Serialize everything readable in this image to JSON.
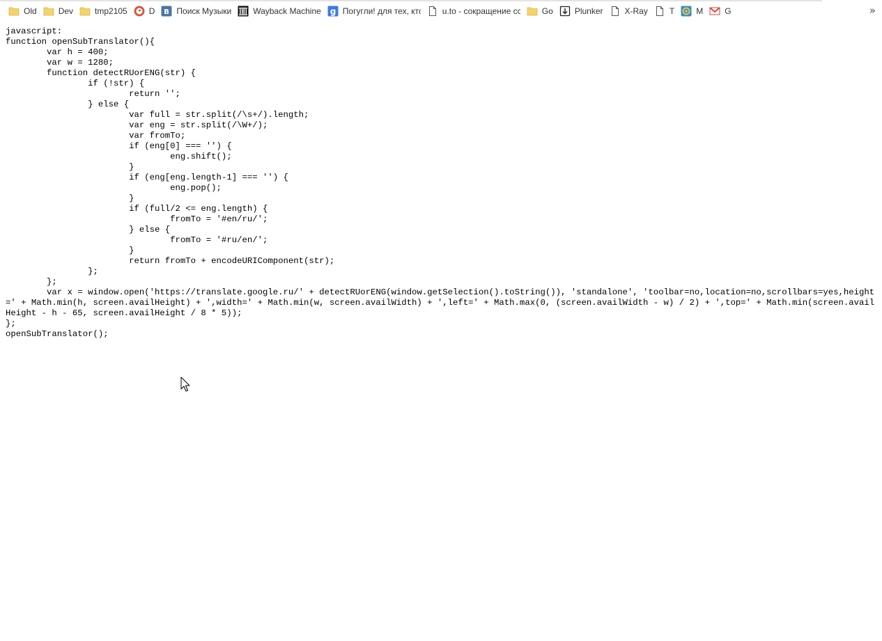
{
  "bookmarks_bar": {
    "items": [
      {
        "label": "Old",
        "icon": "folder-icon"
      },
      {
        "label": "Dev",
        "icon": "folder-icon"
      },
      {
        "label": "tmp2105",
        "icon": "folder-icon"
      },
      {
        "label": "D",
        "icon": "duckduckgo-icon"
      },
      {
        "label": "Поиск Музыки",
        "icon": "vk-icon"
      },
      {
        "label": "Wayback Machine",
        "icon": "wayback-machine-icon"
      },
      {
        "label": "Погугли! для тех, кто",
        "icon": "google-icon"
      },
      {
        "label": "u.to - сокращение ссылок",
        "icon": "page-icon"
      },
      {
        "label": "Go",
        "icon": "folder-icon"
      },
      {
        "label": "Plunker",
        "icon": "plunker-icon"
      },
      {
        "label": "X-Ray",
        "icon": "page-icon"
      },
      {
        "label": "T",
        "icon": "page-icon"
      },
      {
        "label": "M",
        "icon": "target-icon"
      },
      {
        "label": "G",
        "icon": "gmail-icon"
      }
    ],
    "overflow_glyph": "»"
  },
  "colors": {
    "folder": "#f5d36b",
    "vk": "#4c75a3",
    "google": "#3b7be5",
    "gmail_red": "#d44638",
    "text": "#000000"
  },
  "document": {
    "code": "javascript:\nfunction openSubTranslator(){\n\tvar h = 400;\n\tvar w = 1280;\n\tfunction detectRUorENG(str) {\n\t\tif (!str) {\n\t\t\treturn '';\n\t\t} else {\n\t\t\tvar full = str.split(/\\s+/).length;\n\t\t\tvar eng = str.split(/\\W+/);\n\t\t\tvar fromTo;\n\t\t\tif (eng[0] === '') {\n\t\t\t\teng.shift();\n\t\t\t}\n\t\t\tif (eng[eng.length-1] === '') {\n\t\t\t\teng.pop();\n\t\t\t}\n\t\t\tif (full/2 <= eng.length) {\n\t\t\t\tfromTo = '#en/ru/';\n\t\t\t} else {\n\t\t\t\tfromTo = '#ru/en/';\n\t\t\t}\n\t\t\treturn fromTo + encodeURIComponent(str);\n\t\t};\n\t};\n\tvar x = window.open('https://translate.google.ru/' + detectRUorENG(window.getSelection().toString()), 'standalone', 'toolbar=no,location=no,scrollbars=yes,height=' + Math.min(h, screen.availHeight) + ',width=' + Math.min(w, screen.availWidth) + ',left=' + Math.max(0, (screen.availWidth - w) / 2) + ',top=' + Math.min(screen.availHeight - h - 65, screen.availHeight / 8 * 5));\n};\nopenSubTranslator();"
  }
}
